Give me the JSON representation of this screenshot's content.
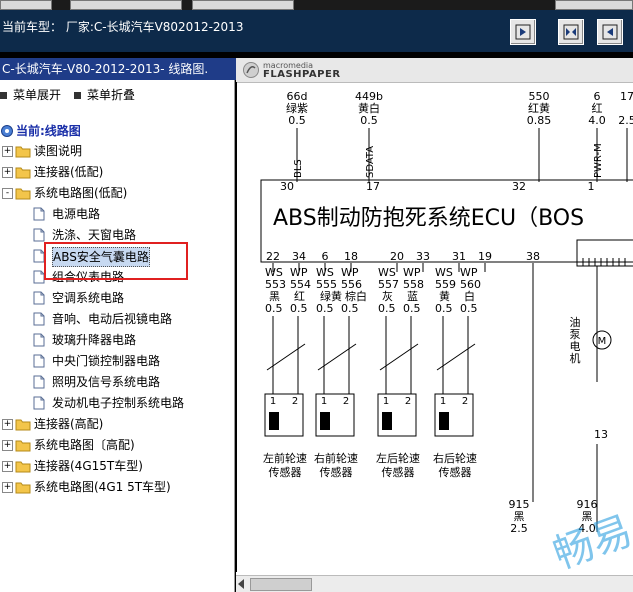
{
  "header": {
    "car_model_label": "当前车型：  厂家:C-长城汽车V802012-2013",
    "nav_buttons": [
      {
        "icon": "step-forward-icon"
      },
      {
        "icon": "double-arrow-icon"
      },
      {
        "icon": "step-back-icon"
      }
    ]
  },
  "sidebar": {
    "title": "C-长城汽车-V80-2012-2013- 线路图.",
    "toolbar": {
      "expand": "菜单展开",
      "collapse": "菜单折叠"
    },
    "root": "当前:线路图",
    "nodes": [
      {
        "label": "读图说明",
        "type": "folder",
        "pm": "+",
        "level": 1
      },
      {
        "label": "连接器(低配)",
        "type": "folder",
        "pm": "+",
        "level": 1
      },
      {
        "label": "系统电路图(低配)",
        "type": "folder",
        "pm": "-",
        "level": 1
      },
      {
        "label": "电源电路",
        "type": "doc",
        "level": 2
      },
      {
        "label": "洗涤、天窗电路",
        "type": "doc",
        "level": 2
      },
      {
        "label": "ABS安全气囊电路",
        "type": "doc",
        "level": 2,
        "selected": true
      },
      {
        "label": "组合仪表电路",
        "type": "doc",
        "level": 2
      },
      {
        "label": "空调系统电路",
        "type": "doc",
        "level": 2
      },
      {
        "label": "音响、电动后视镜电路",
        "type": "doc",
        "level": 2
      },
      {
        "label": "玻璃升降器电路",
        "type": "doc",
        "level": 2
      },
      {
        "label": "中央门锁控制器电路",
        "type": "doc",
        "level": 2
      },
      {
        "label": "照明及信号系统电路",
        "type": "doc",
        "level": 2
      },
      {
        "label": "发动机电子控制系统电路",
        "type": "doc",
        "level": 2
      },
      {
        "label": "连接器(高配)",
        "type": "folder",
        "pm": "+",
        "level": 1
      },
      {
        "label": "系统电路图〔高配)",
        "type": "folder",
        "pm": "+",
        "level": 1
      },
      {
        "label": "连接器(4G15T车型)",
        "type": "folder",
        "pm": "+",
        "level": 1
      },
      {
        "label": "系统电路图(4G1 5T车型)",
        "type": "folder",
        "pm": "+",
        "level": 1
      }
    ]
  },
  "viewer": {
    "brand_line1": "macromedia",
    "brand_line2": "FLASHPAPER",
    "diagram": {
      "ecu_title": "ABS制动防抱死系统ECU（BOS",
      "top_wires": [
        {
          "code": "66d",
          "color": "绿紫",
          "size": "0.5",
          "signal": "BLS",
          "pin": "30"
        },
        {
          "code": "449b",
          "color": "黄白",
          "size": "0.5",
          "signal": "SDATA",
          "pin": "17"
        },
        {
          "code": "550",
          "color": "红黄",
          "size": "0.85",
          "signal": "",
          "pin": "32"
        },
        {
          "code": "6",
          "color": "红",
          "size": "4.0",
          "signal": "PWR-M",
          "pin": "1"
        },
        {
          "code": "17",
          "color": "",
          "size": "2.5",
          "signal": "",
          "pin": ""
        }
      ],
      "bottom_pins": [
        "22",
        "34",
        "6",
        "18",
        "20",
        "33",
        "31",
        "19",
        "38"
      ],
      "wire_groups": [
        {
          "a": {
            "type": "WS",
            "num": "553",
            "color": "黑",
            "size": "0.5"
          },
          "b": {
            "type": "WP",
            "num": "554",
            "color": "红",
            "size": "0.5"
          },
          "sensor": "左前轮速\n传感器"
        },
        {
          "a": {
            "type": "WS",
            "num": "555",
            "color": "绿黄",
            "size": "0.5"
          },
          "b": {
            "type": "WP",
            "num": "556",
            "color": "棕白",
            "size": "0.5"
          },
          "sensor": "右前轮速\n传感器"
        },
        {
          "a": {
            "type": "WS",
            "num": "557",
            "color": "灰",
            "size": "0.5"
          },
          "b": {
            "type": "WP",
            "num": "558",
            "color": "蓝",
            "size": "0.5"
          },
          "sensor": "左后轮速\n传感器"
        },
        {
          "a": {
            "type": "WS",
            "num": "559",
            "color": "黄",
            "size": "0.5"
          },
          "b": {
            "type": "WP",
            "num": "560",
            "color": "白",
            "size": "0.5"
          },
          "sensor": "右后轮速\n传感器"
        }
      ],
      "sensor_pins": [
        "1",
        "2"
      ],
      "pump_label": "油\n泵\n电\n机",
      "pin13": "13",
      "ground_wires": [
        {
          "code": "915",
          "color": "黑",
          "size": "2.5"
        },
        {
          "code": "916",
          "color": "黑",
          "size": "4.0"
        }
      ],
      "watermark": "畅易"
    }
  }
}
